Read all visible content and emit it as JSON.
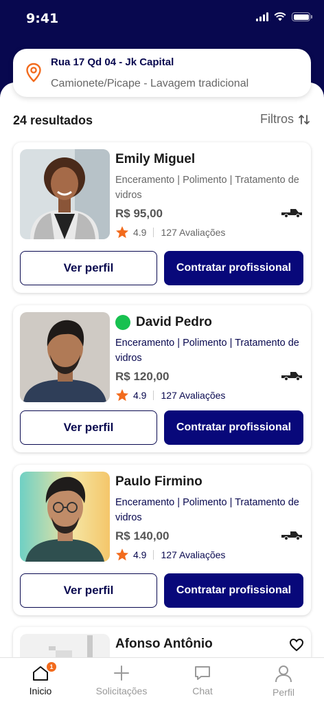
{
  "status_bar": {
    "time": "9:41"
  },
  "address": {
    "title": "Rua 17 Qd 04 - Jk Capital",
    "subtitle": "Camionete/Picape - Lavagem tradicional"
  },
  "results": {
    "count_label": "24 resultados",
    "filters_label": "Filtros"
  },
  "professionals": [
    {
      "name": "Emily Miguel",
      "online": false,
      "services": "Enceramento | Polimento | Tratamento de vidros",
      "price": "R$ 95,00",
      "rating": "4.9",
      "reviews": "127 Avaliações",
      "profile_button": "Ver perfil",
      "hire_button": "Contratar profissional"
    },
    {
      "name": "David Pedro",
      "online": true,
      "services": "Enceramento | Polimento | Tratamento de vidros",
      "price": "R$ 120,00",
      "rating": "4.9",
      "reviews": "127 Avaliações",
      "profile_button": "Ver perfil",
      "hire_button": "Contratar profissional"
    },
    {
      "name": "Paulo Firmino",
      "online": false,
      "services": "Enceramento | Polimento | Tratamento de vidros",
      "price": "R$ 140,00",
      "rating": "4.9",
      "reviews": "127 Avaliações",
      "profile_button": "Ver perfil",
      "hire_button": "Contratar profissional"
    },
    {
      "name": "Afonso Antônio"
    }
  ],
  "tab_bar": {
    "tabs": [
      {
        "label": "Inicio",
        "icon": "home-icon",
        "badge": "1"
      },
      {
        "label": "Solicitações",
        "icon": "plus-icon"
      },
      {
        "label": "Chat",
        "icon": "chat-icon"
      },
      {
        "label": "Perfil",
        "icon": "user-icon"
      }
    ]
  },
  "colors": {
    "primary": "#08084f",
    "accent": "#f26b1d",
    "online": "#17c150"
  }
}
